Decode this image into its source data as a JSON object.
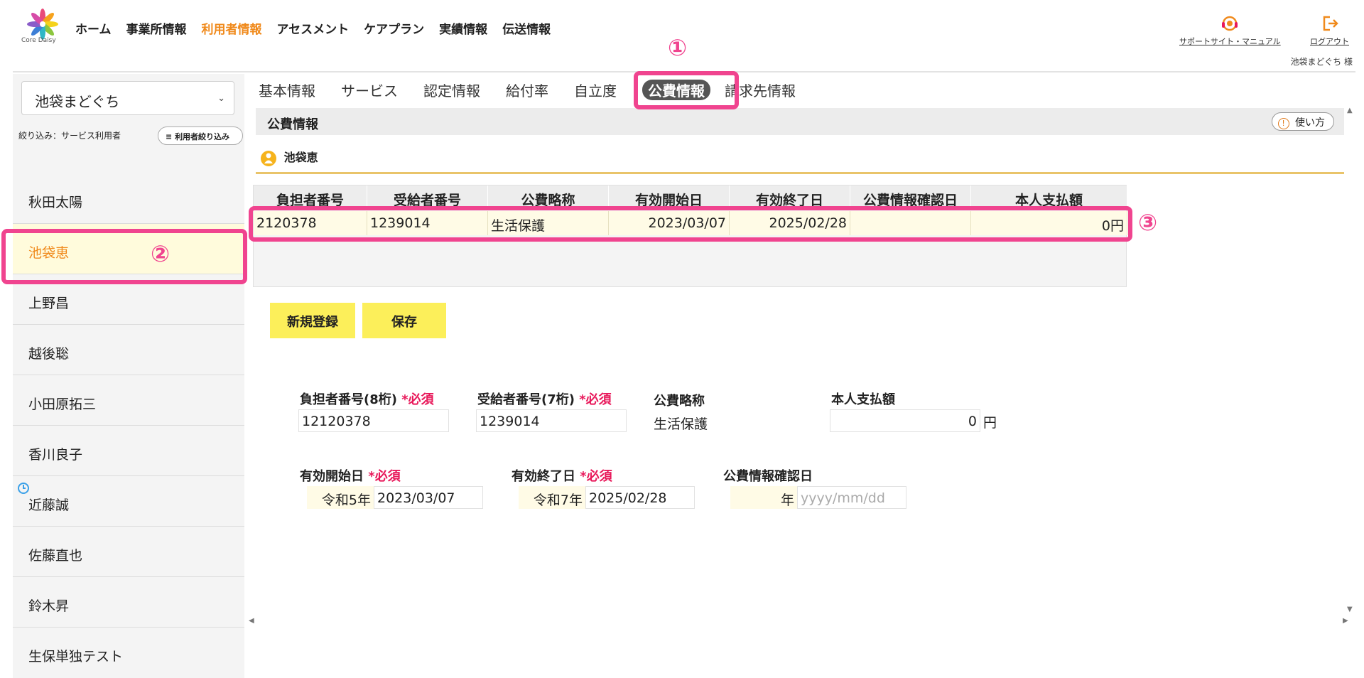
{
  "header": {
    "logo_text": "Core Daisy",
    "nav": [
      "ホーム",
      "事業所情報",
      "利用者情報",
      "アセスメント",
      "ケアプラン",
      "実績情報",
      "伝送情報"
    ],
    "nav_active_index": 2,
    "support_link": "サポートサイト・マニュアル",
    "logout_link": "ログアウト",
    "user_name": "池袋まどぐち 様"
  },
  "sidebar": {
    "selected_office": "池袋まどぐち",
    "filter_label": "絞り込み：サービス利用者",
    "filter_button": "利用者絞り込み",
    "users": [
      "秋田太陽",
      "池袋恵",
      "上野昌",
      "越後聡",
      "小田原拓三",
      "香川良子",
      "近藤誠",
      "佐藤直也",
      "鈴木昇",
      "生保単独テスト"
    ],
    "selected_index": 1
  },
  "tabs": [
    "基本情報",
    "サービス",
    "認定情報",
    "給付率",
    "自立度",
    "公費情報",
    "請求先情報"
  ],
  "active_tab_index": 5,
  "panel": {
    "title": "公費情報",
    "help_button": "使い方",
    "person_name": "池袋恵"
  },
  "grid": {
    "headers": [
      "負担者番号",
      "受給者番号",
      "公費略称",
      "有効開始日",
      "有効終了日",
      "公費情報確認日",
      "本人支払額"
    ],
    "rows": [
      [
        "2120378",
        "1239014",
        "生活保護",
        "2023/03/07",
        "2025/02/28",
        "",
        "0円"
      ]
    ]
  },
  "buttons": {
    "new": "新規登録",
    "save": "保存"
  },
  "form": {
    "payer_label": "負担者番号(8桁)",
    "recipient_label": "受給者番号(7桁)",
    "abbr_label": "公費略称",
    "payment_label": "本人支払額",
    "required_mark": "*必須",
    "payer_value": "12120378",
    "recipient_value": "1239014",
    "abbr_value": "生活保護",
    "payment_value": "0",
    "payment_unit": "円",
    "start_label": "有効開始日",
    "end_label": "有効終了日",
    "confirm_label": "公費情報確認日",
    "start_era": "令和5年",
    "start_value": "2023/03/07",
    "end_era": "令和7年",
    "end_value": "2025/02/28",
    "confirm_era": "年",
    "confirm_placeholder": "yyyy/mm/dd"
  },
  "annotations": [
    "①",
    "②",
    "③"
  ],
  "colors": {
    "accent": "#f08a1c",
    "highlight": "#f0448f",
    "button": "#fcef5a",
    "required": "#e8185a",
    "rule": "#e9c46a"
  }
}
